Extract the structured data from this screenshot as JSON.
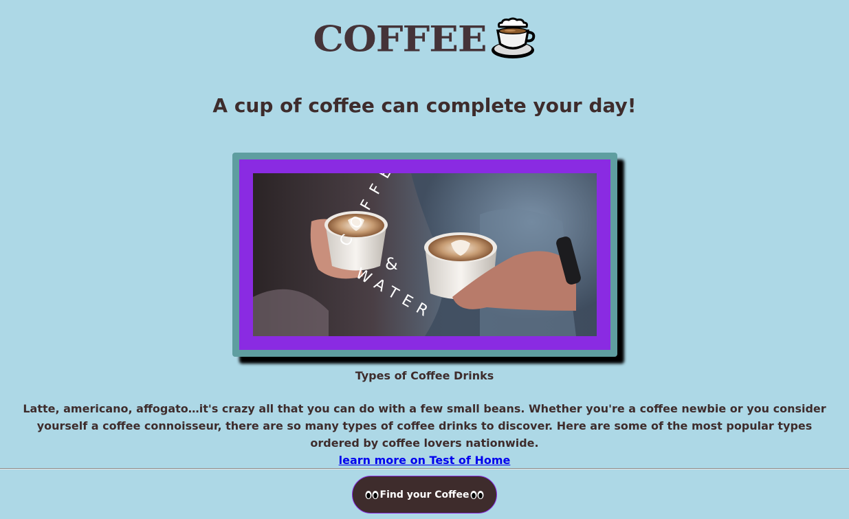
{
  "header": {
    "logo_text": "COFFEE",
    "logo_icon": "hot-beverage-icon"
  },
  "tagline": "A cup of coffee can complete your day!",
  "hero": {
    "overlay_line1": "COFFEE",
    "overlay_amp": "&",
    "overlay_line2": "WATER"
  },
  "content": {
    "caption": "Types of Coffee Drinks",
    "intro": "Latte, americano, affogato…it's crazy all that you can do with a few small beans. Whether you're a coffee newbie or you consider yourself a coffee connoisseur, there are so many types of coffee drinks to discover. Here are some of the most popular types ordered by coffee lovers nationwide.",
    "link_text": "learn more on Test of Home"
  },
  "cta": {
    "label": "Find your Coffee",
    "icon": "eyes-icon"
  },
  "colors": {
    "background": "#add8e6",
    "frame_outer": "#5f9ea0",
    "frame_inner": "#8a2be2",
    "text": "#3e2c2c",
    "button": "#3e2c2c",
    "link": "#0000ee"
  }
}
